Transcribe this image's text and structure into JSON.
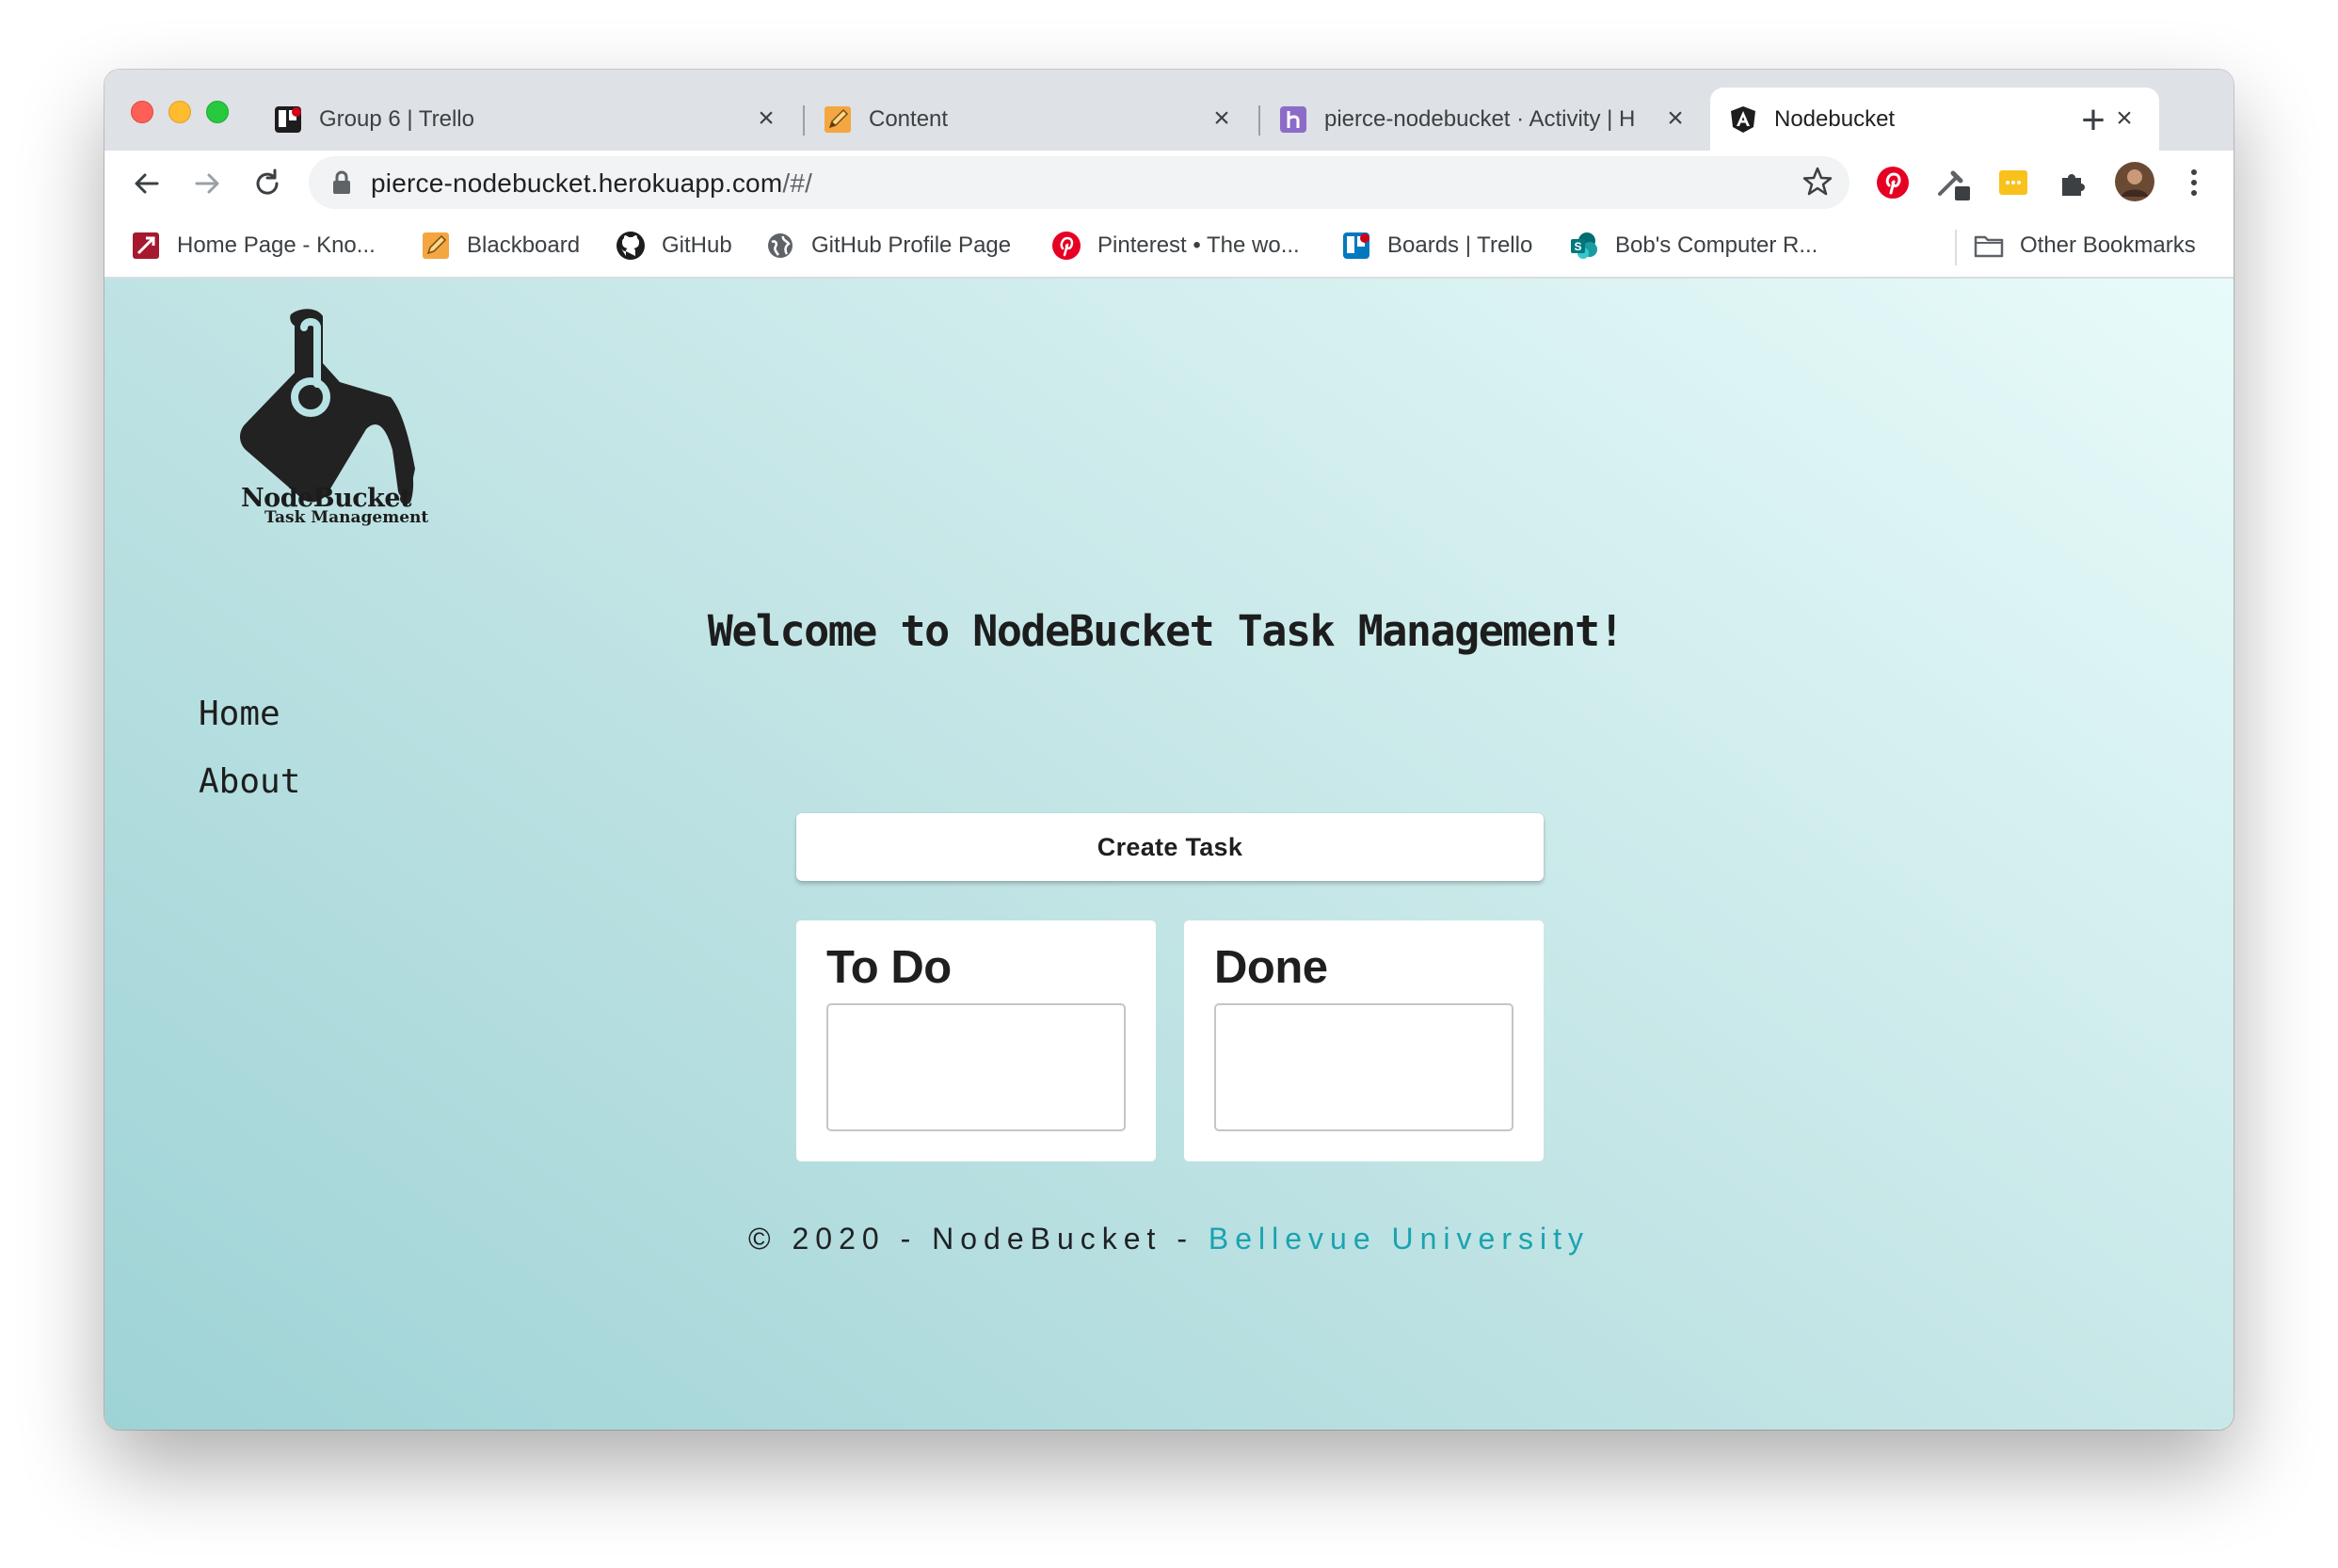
{
  "browser": {
    "tabs": [
      {
        "title": "Group 6 | Trello",
        "icon": "trello-icon",
        "active": false
      },
      {
        "title": "Content",
        "icon": "pencil-icon",
        "active": false
      },
      {
        "title": "pierce-nodebucket · Activity | H",
        "icon": "heroku-icon",
        "active": false
      },
      {
        "title": "Nodebucket",
        "icon": "angular-icon",
        "active": true
      }
    ],
    "close_glyph": "×",
    "new_tab_glyph": "+",
    "address_bar": {
      "host": "pierce-nodebucket.herokuapp.com",
      "path": "/#/"
    },
    "bookmarks": [
      {
        "label": "Home Page - Kno...",
        "icon": "knowledge-icon"
      },
      {
        "label": "Blackboard",
        "icon": "pencil-icon"
      },
      {
        "label": "GitHub",
        "icon": "github-icon"
      },
      {
        "label": "GitHub Profile Page",
        "icon": "globe-icon"
      },
      {
        "label": "Pinterest • The wo...",
        "icon": "pinterest-icon"
      },
      {
        "label": "Boards | Trello",
        "icon": "trello-icon"
      },
      {
        "label": "Bob's Computer R...",
        "icon": "sharepoint-icon"
      }
    ],
    "other_bookmarks": "Other Bookmarks"
  },
  "app": {
    "logo": {
      "title": "NodeBucket",
      "subtitle": "Task Management"
    },
    "nav": [
      {
        "label": "Home"
      },
      {
        "label": "About"
      }
    ],
    "welcome": "Welcome to NodeBucket Task Management!",
    "create_task_label": "Create Task",
    "columns": [
      {
        "title": "To Do"
      },
      {
        "title": "Done"
      }
    ],
    "footer": {
      "text": "© 2020 - NodeBucket - ",
      "link": "Bellevue University"
    }
  },
  "colors": {
    "accent_link": "#1aa3b0",
    "page_gradient_start": "#9ed3d6",
    "page_gradient_end": "#e8fbfa"
  }
}
